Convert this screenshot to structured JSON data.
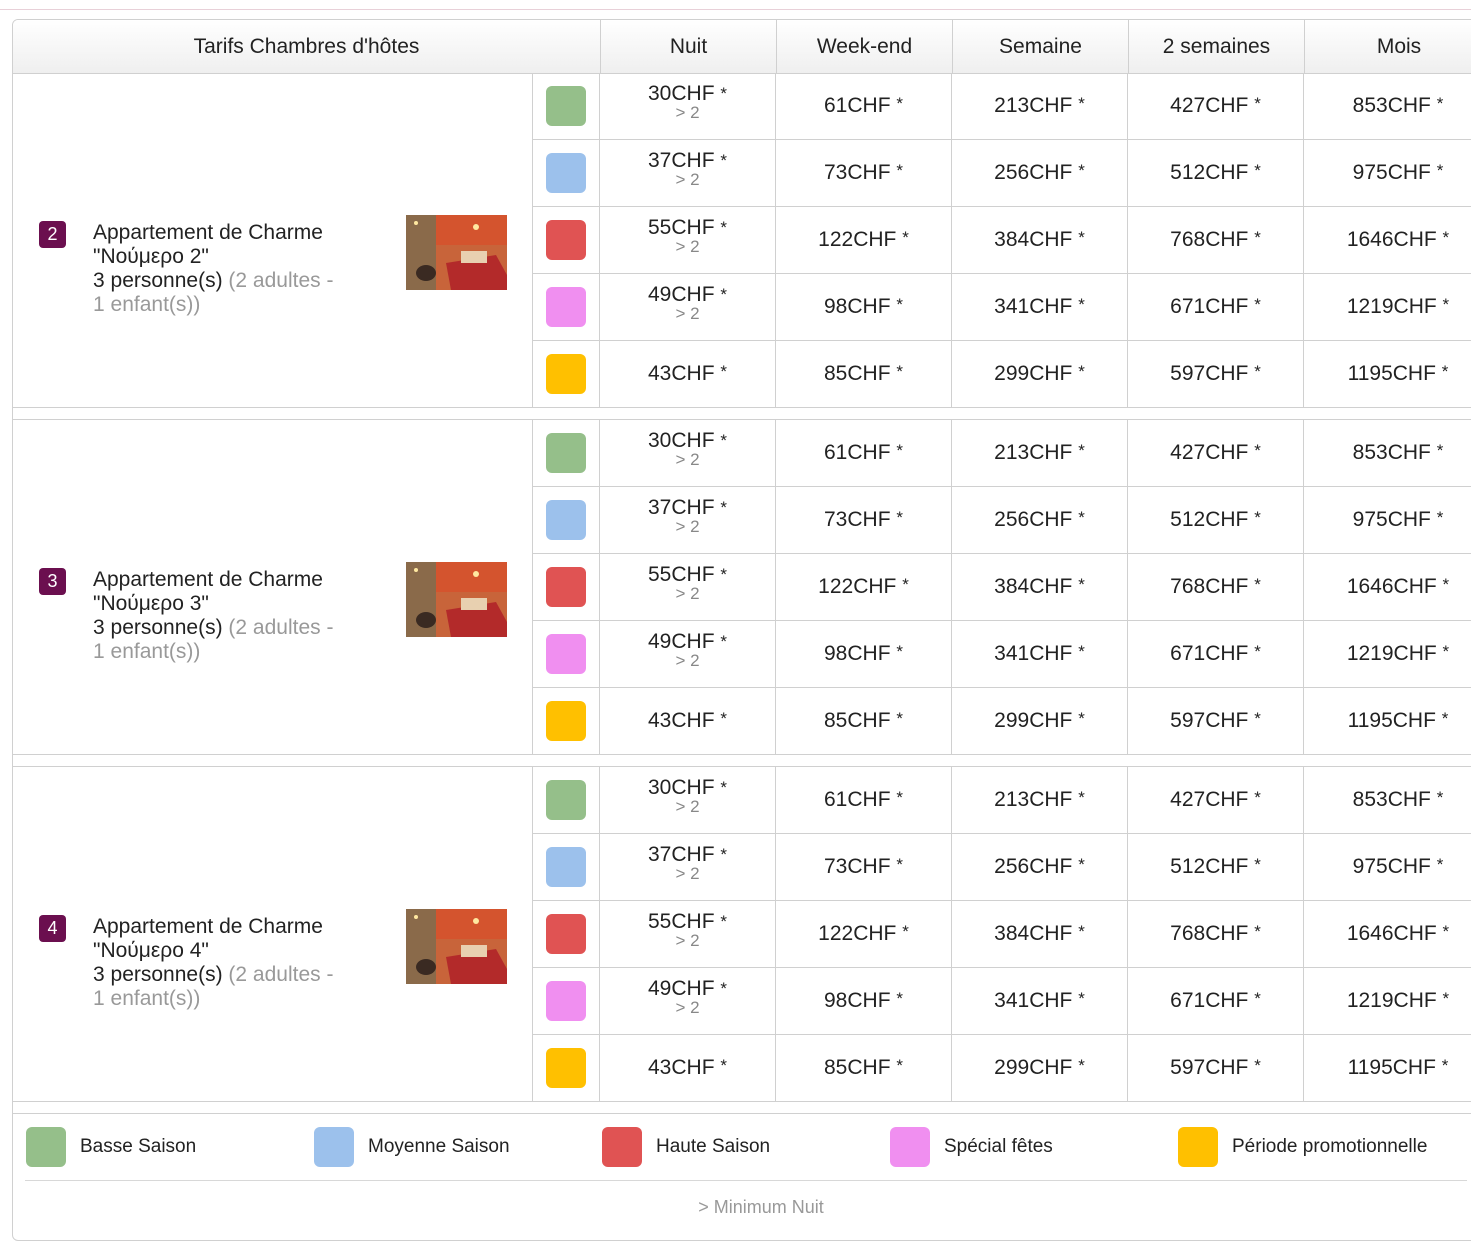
{
  "headers": [
    "Tarifs Chambres d'hôtes",
    "Nuit",
    "Week-end",
    "Semaine",
    "2 semaines",
    "Mois"
  ],
  "seasons": [
    {
      "name": "Basse Saison",
      "color": "#95bf8a"
    },
    {
      "name": "Moyenne Saison",
      "color": "#9cc1ec"
    },
    {
      "name": "Haute Saison",
      "color": "#e05353"
    },
    {
      "name": "Spécial fêtes",
      "color": "#f08ff0"
    },
    {
      "name": "Période promotionnelle",
      "color": "#ffc000"
    }
  ],
  "rooms": [
    {
      "number": "2",
      "name_line1": "Appartement de Charme",
      "name_line2": "\"Νούμερο 2\"",
      "capacity": "3 personne(s)",
      "detail1": "(2 adultes -",
      "detail2": "1 enfant(s))",
      "rates": [
        {
          "nuit": "30CHF",
          "min": "> 2",
          "weekend": "61CHF",
          "semaine": "213CHF",
          "deux_semaines": "427CHF",
          "mois": "853CHF"
        },
        {
          "nuit": "37CHF",
          "min": "> 2",
          "weekend": "73CHF",
          "semaine": "256CHF",
          "deux_semaines": "512CHF",
          "mois": "975CHF"
        },
        {
          "nuit": "55CHF",
          "min": "> 2",
          "weekend": "122CHF",
          "semaine": "384CHF",
          "deux_semaines": "768CHF",
          "mois": "1646CHF"
        },
        {
          "nuit": "49CHF",
          "min": "> 2",
          "weekend": "98CHF",
          "semaine": "341CHF",
          "deux_semaines": "671CHF",
          "mois": "1219CHF"
        },
        {
          "nuit": "43CHF",
          "min": "",
          "weekend": "85CHF",
          "semaine": "299CHF",
          "deux_semaines": "597CHF",
          "mois": "1195CHF"
        }
      ]
    },
    {
      "number": "3",
      "name_line1": "Appartement de Charme",
      "name_line2": "\"Νούμερο 3\"",
      "capacity": "3 personne(s)",
      "detail1": "(2 adultes -",
      "detail2": "1 enfant(s))",
      "rates": [
        {
          "nuit": "30CHF",
          "min": "> 2",
          "weekend": "61CHF",
          "semaine": "213CHF",
          "deux_semaines": "427CHF",
          "mois": "853CHF"
        },
        {
          "nuit": "37CHF",
          "min": "> 2",
          "weekend": "73CHF",
          "semaine": "256CHF",
          "deux_semaines": "512CHF",
          "mois": "975CHF"
        },
        {
          "nuit": "55CHF",
          "min": "> 2",
          "weekend": "122CHF",
          "semaine": "384CHF",
          "deux_semaines": "768CHF",
          "mois": "1646CHF"
        },
        {
          "nuit": "49CHF",
          "min": "> 2",
          "weekend": "98CHF",
          "semaine": "341CHF",
          "deux_semaines": "671CHF",
          "mois": "1219CHF"
        },
        {
          "nuit": "43CHF",
          "min": "",
          "weekend": "85CHF",
          "semaine": "299CHF",
          "deux_semaines": "597CHF",
          "mois": "1195CHF"
        }
      ]
    },
    {
      "number": "4",
      "name_line1": "Appartement de Charme",
      "name_line2": "\"Νούμερο 4\"",
      "capacity": "3 personne(s)",
      "detail1": "(2 adultes -",
      "detail2": "1 enfant(s))",
      "rates": [
        {
          "nuit": "30CHF",
          "min": "> 2",
          "weekend": "61CHF",
          "semaine": "213CHF",
          "deux_semaines": "427CHF",
          "mois": "853CHF"
        },
        {
          "nuit": "37CHF",
          "min": "> 2",
          "weekend": "73CHF",
          "semaine": "256CHF",
          "deux_semaines": "512CHF",
          "mois": "975CHF"
        },
        {
          "nuit": "55CHF",
          "min": "> 2",
          "weekend": "122CHF",
          "semaine": "384CHF",
          "deux_semaines": "768CHF",
          "mois": "1646CHF"
        },
        {
          "nuit": "49CHF",
          "min": "> 2",
          "weekend": "98CHF",
          "semaine": "341CHF",
          "deux_semaines": "671CHF",
          "mois": "1219CHF"
        },
        {
          "nuit": "43CHF",
          "min": "",
          "weekend": "85CHF",
          "semaine": "299CHF",
          "deux_semaines": "597CHF",
          "mois": "1195CHF"
        }
      ]
    }
  ],
  "star": "*",
  "footnote": "> Minimum Nuit"
}
